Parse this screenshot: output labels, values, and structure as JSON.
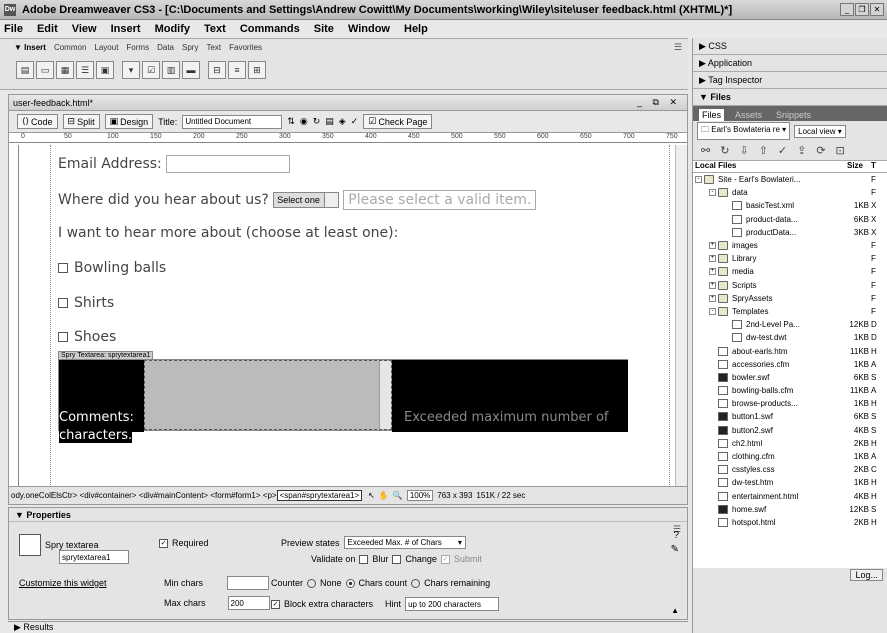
{
  "window": {
    "title": "Adobe Dreamweaver CS3 - [C:\\Documents and Settings\\Andrew Cowitt\\My Documents\\working\\Wiley\\site\\user feedback.html (XHTML)*]",
    "icon_label": "Dw"
  },
  "menu": [
    "File",
    "Edit",
    "View",
    "Insert",
    "Modify",
    "Text",
    "Commands",
    "Site",
    "Window",
    "Help"
  ],
  "insert_bar": {
    "label": "▼ Insert",
    "tabs": [
      "Common",
      "Layout",
      "Forms",
      "Data",
      "Spry",
      "Text",
      "Favorites"
    ],
    "icons": [
      "spry-data-set-icon",
      "spry-region-icon",
      "spry-repeat-icon",
      "spry-repeat-list-icon",
      "spry-validation-text-icon",
      "spry-validation-select-icon",
      "spry-validation-checkbox-icon",
      "spry-validation-textarea-icon",
      "spry-menubar-icon",
      "spry-tabbed-panels-icon",
      "spry-accordion-icon",
      "spry-collapsible-panel-icon"
    ]
  },
  "document": {
    "tab": "user-feedback.html*",
    "controls": "_ ⧉ ✕",
    "toolbar": {
      "code": "Code",
      "split": "Split",
      "design": "Design",
      "title_label": "Title:",
      "title_value": "Untitled Document",
      "check_page": "Check Page"
    },
    "ruler_ticks": [
      "0",
      "50",
      "100",
      "150",
      "200",
      "250",
      "300",
      "350",
      "400",
      "450",
      "500",
      "550",
      "600",
      "650",
      "700",
      "750"
    ],
    "form": {
      "email_label": "Email Address:",
      "hear_label": "Where did you hear about us?",
      "select_value": "Select one",
      "select_error": "Please select a valid item.",
      "interest_label": "I want to hear more about (choose at least one):",
      "options": [
        "Bowling balls",
        "Shirts",
        "Shoes"
      ],
      "spry_label": "Spry Textarea: sprytextarea1",
      "comments_label": "Comments:",
      "comments_tail": "characters.",
      "exceeded_msg": "Exceeded maximum number of"
    },
    "tag_selector": {
      "tags": "ody.oneColElsCtr> <div#container> <div#mainContent> <form#form1> <p>",
      "selected": "<span#sprytextarea1>",
      "zoom": "100%",
      "size": "763 x 393",
      "weight": "151K / 22 sec"
    }
  },
  "properties": {
    "header": "▼ Properties",
    "widget_type": "Spry textarea",
    "widget_name": "sprytextarea1",
    "required_label": "Required",
    "customize": "Customize this widget",
    "preview_label": "Preview states",
    "preview_value": "Exceeded Max. # of Chars",
    "validate_label": "Validate on",
    "validate_opts": [
      "Blur",
      "Change",
      "Submit"
    ],
    "min_label": "Min chars",
    "min_value": "",
    "max_label": "Max chars",
    "max_value": "200",
    "counter_label": "Counter",
    "counter_opts": [
      "None",
      "Chars count",
      "Chars remaining"
    ],
    "block_label": "Block extra characters",
    "hint_label": "Hint",
    "hint_value": "up to 200 characters"
  },
  "results": "▶ Results",
  "right_panel": {
    "sections": [
      "▶ CSS",
      "▶ Application",
      "▶ Tag Inspector",
      "▼ Files"
    ],
    "file_tabs": [
      "Files",
      "Assets",
      "Snippets"
    ],
    "site_select": "Earl's Bowlateria re",
    "view_select": "Local view",
    "col_local": "Local Files",
    "col_size": "Size",
    "col_type": "T",
    "files": [
      {
        "name": "Site - Earl's Bowlateri...",
        "size": "",
        "type": "F",
        "indent": 0,
        "kind": "folder",
        "pm": "-"
      },
      {
        "name": "data",
        "size": "",
        "type": "F",
        "indent": 1,
        "kind": "folder",
        "pm": "-"
      },
      {
        "name": "basicTest.xml",
        "size": "1KB",
        "type": "X",
        "indent": 2,
        "kind": "file",
        "pm": ""
      },
      {
        "name": "product-data...",
        "size": "6KB",
        "type": "X",
        "indent": 2,
        "kind": "file",
        "pm": ""
      },
      {
        "name": "productData...",
        "size": "3KB",
        "type": "X",
        "indent": 2,
        "kind": "file",
        "pm": ""
      },
      {
        "name": "images",
        "size": "",
        "type": "F",
        "indent": 1,
        "kind": "folder",
        "pm": "+"
      },
      {
        "name": "Library",
        "size": "",
        "type": "F",
        "indent": 1,
        "kind": "folder",
        "pm": "+"
      },
      {
        "name": "media",
        "size": "",
        "type": "F",
        "indent": 1,
        "kind": "folder",
        "pm": "+"
      },
      {
        "name": "Scripts",
        "size": "",
        "type": "F",
        "indent": 1,
        "kind": "folder",
        "pm": "+"
      },
      {
        "name": "SpryAssets",
        "size": "",
        "type": "F",
        "indent": 1,
        "kind": "folder",
        "pm": "+"
      },
      {
        "name": "Templates",
        "size": "",
        "type": "F",
        "indent": 1,
        "kind": "folder",
        "pm": "-"
      },
      {
        "name": "2nd-Level Pa...",
        "size": "12KB",
        "type": "D",
        "indent": 2,
        "kind": "file",
        "pm": ""
      },
      {
        "name": "dw-test.dwt",
        "size": "1KB",
        "type": "D",
        "indent": 2,
        "kind": "file",
        "pm": ""
      },
      {
        "name": "about-earls.htm",
        "size": "11KB",
        "type": "H",
        "indent": 1,
        "kind": "file",
        "pm": ""
      },
      {
        "name": "accessories.cfm",
        "size": "1KB",
        "type": "A",
        "indent": 1,
        "kind": "file",
        "pm": ""
      },
      {
        "name": "bowler.swf",
        "size": "6KB",
        "type": "S",
        "indent": 1,
        "kind": "swf",
        "pm": ""
      },
      {
        "name": "bowling-balls.cfm",
        "size": "11KB",
        "type": "A",
        "indent": 1,
        "kind": "file",
        "pm": ""
      },
      {
        "name": "browse-products...",
        "size": "1KB",
        "type": "H",
        "indent": 1,
        "kind": "file",
        "pm": ""
      },
      {
        "name": "button1.swf",
        "size": "6KB",
        "type": "S",
        "indent": 1,
        "kind": "swf",
        "pm": ""
      },
      {
        "name": "button2.swf",
        "size": "4KB",
        "type": "S",
        "indent": 1,
        "kind": "swf",
        "pm": ""
      },
      {
        "name": "ch2.html",
        "size": "2KB",
        "type": "H",
        "indent": 1,
        "kind": "file",
        "pm": ""
      },
      {
        "name": "clothing.cfm",
        "size": "1KB",
        "type": "A",
        "indent": 1,
        "kind": "file",
        "pm": ""
      },
      {
        "name": "csstyles.css",
        "size": "2KB",
        "type": "C",
        "indent": 1,
        "kind": "file",
        "pm": ""
      },
      {
        "name": "dw-test.htm",
        "size": "1KB",
        "type": "H",
        "indent": 1,
        "kind": "file",
        "pm": ""
      },
      {
        "name": "entertainment.html",
        "size": "4KB",
        "type": "H",
        "indent": 1,
        "kind": "file",
        "pm": ""
      },
      {
        "name": "home.swf",
        "size": "12KB",
        "type": "S",
        "indent": 1,
        "kind": "swf",
        "pm": ""
      },
      {
        "name": "hotspot.html",
        "size": "2KB",
        "type": "H",
        "indent": 1,
        "kind": "file",
        "pm": ""
      }
    ],
    "log_button": "Log..."
  }
}
